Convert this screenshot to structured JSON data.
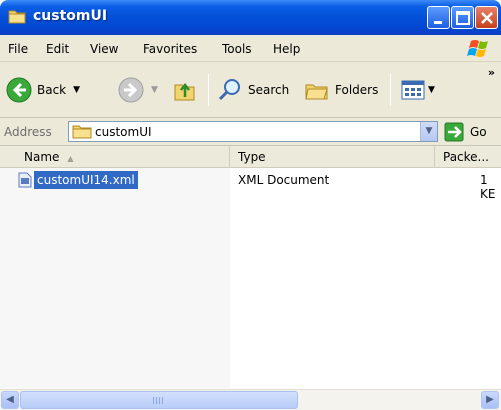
{
  "window": {
    "title": "customUI"
  },
  "menu": {
    "items": [
      "File",
      "Edit",
      "View",
      "Favorites",
      "Tools",
      "Help"
    ]
  },
  "toolbar": {
    "back_label": "Back",
    "search_label": "Search",
    "folders_label": "Folders",
    "more": "»"
  },
  "address": {
    "label": "Address",
    "value": "customUI",
    "go_label": "Go"
  },
  "columns": {
    "name": "Name",
    "type": "Type",
    "packed": "Packe..."
  },
  "files": [
    {
      "name": "customUI14.xml",
      "type": "XML Document",
      "size": "1 KE"
    }
  ],
  "colors": {
    "title_bar": "#0350d8",
    "selection": "#316ac5",
    "chrome": "#ece9d8"
  }
}
